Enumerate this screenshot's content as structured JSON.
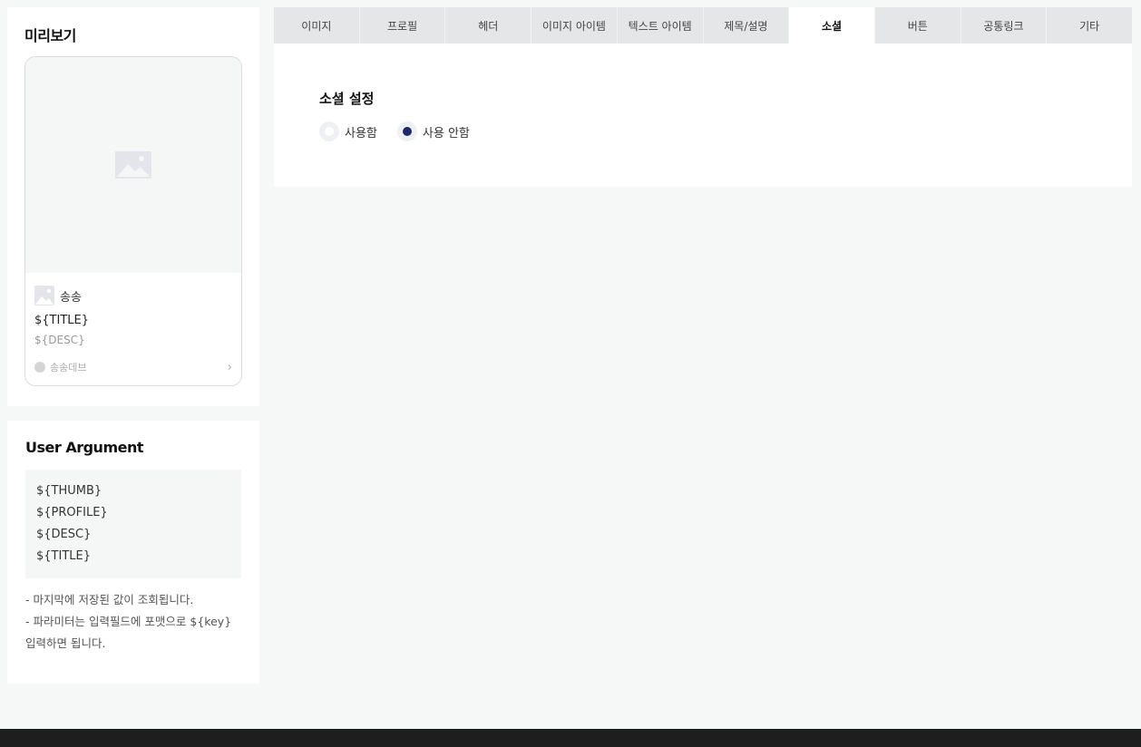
{
  "preview": {
    "title": "미리보기",
    "card": {
      "thumb_icon": "image-placeholder-icon",
      "profile_name": "송송",
      "title": "${TITLE}",
      "desc": "${DESC}",
      "dev_name": "송송데브",
      "chevron": "›"
    }
  },
  "user_argument": {
    "title": "User Argument",
    "args": [
      "${THUMB}",
      "${PROFILE}",
      "${DESC}",
      "${TITLE}"
    ],
    "notes": [
      "- 마지막에 저장된 값이 조회됩니다.",
      "- 파라미터는 입력필드에 포맷으로 ${key} 입력하면 됩니다."
    ]
  },
  "tabs": [
    {
      "label": "이미지",
      "active": false
    },
    {
      "label": "프로필",
      "active": false
    },
    {
      "label": "헤더",
      "active": false
    },
    {
      "label": "이미지 아이템",
      "active": false
    },
    {
      "label": "텍스트 아이템",
      "active": false
    },
    {
      "label": "제목/설명",
      "active": false
    },
    {
      "label": "소셜",
      "active": true
    },
    {
      "label": "버튼",
      "active": false
    },
    {
      "label": "공통링크",
      "active": false
    },
    {
      "label": "기타",
      "active": false
    }
  ],
  "social": {
    "section_title": "소셜 설정",
    "options": [
      {
        "label": "사용함",
        "checked": false
      },
      {
        "label": "사용 안함",
        "checked": true
      }
    ]
  },
  "colors": {
    "accent": "#1a2a6c",
    "tab_inactive": "#e5e6e7",
    "background": "#f6f7f7",
    "footer": "#1e1e1e"
  }
}
